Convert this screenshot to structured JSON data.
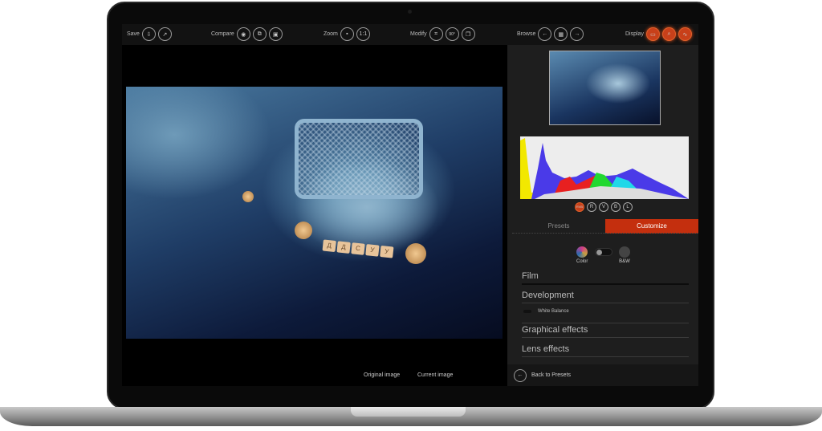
{
  "toolbar": {
    "save": {
      "label": "Save",
      "icons": [
        "save-icon",
        "export-icon"
      ]
    },
    "compare": {
      "label": "Compare",
      "icons": [
        "eye-icon",
        "split-compare-icon",
        "before-after-icon"
      ]
    },
    "zoom": {
      "label": "Zoom",
      "icons": [
        "fit-icon"
      ],
      "one_to_one": "1:1"
    },
    "modify": {
      "label": "Modify",
      "icons": [
        "crop-icon",
        "rotate-icon",
        "copy-icon"
      ],
      "rotate": "90°"
    },
    "browse": {
      "label": "Browse",
      "icons": [
        "arrow-left-icon",
        "grid-icon",
        "arrow-right-icon"
      ]
    },
    "display": {
      "label": "Display",
      "icons": [
        "monitor-icon",
        "loupe-icon",
        "histogram-icon"
      ]
    }
  },
  "viewer": {
    "original_label": "Original image",
    "current_label": "Current image",
    "keys": [
      "Д",
      "Д",
      "С",
      "У",
      "У"
    ]
  },
  "histogram": {
    "channels": [
      "RVB",
      "R",
      "V",
      "B",
      "L"
    ],
    "active": "RVB"
  },
  "tabs": [
    {
      "label": "Presets",
      "active": false
    },
    {
      "label": "Customize",
      "active": true
    }
  ],
  "mode": {
    "color_label": "Color",
    "bw_label": "B&W",
    "selected": "Color"
  },
  "sections": {
    "film": "Film",
    "development": "Development",
    "white_balance": "White Balance",
    "graphical": "Graphical effects",
    "lens": "Lens effects"
  },
  "back_label": "Back to Presets",
  "colors": {
    "accent": "#c42f0e",
    "panel": "#1e1e1e"
  }
}
